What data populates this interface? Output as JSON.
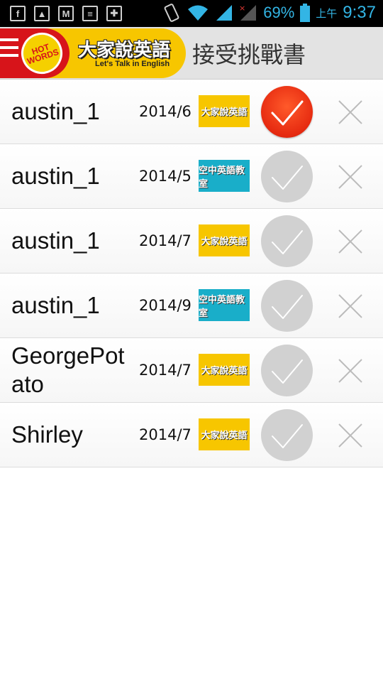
{
  "status_bar": {
    "battery": "69%",
    "time_prefix": "上午",
    "time": "9:37",
    "icons": [
      "facebook-icon",
      "gallery-icon",
      "gmail-icon",
      "bible-icon",
      "puzzle-icon",
      "vibrate-icon",
      "wifi-icon",
      "signal-icon",
      "no-signal-icon",
      "battery-icon"
    ]
  },
  "header": {
    "logo_text": "大家說英語",
    "logo_sub": "Let's Talk in English",
    "logo_badge": "HOT WORDS",
    "title": "接受挑戰書"
  },
  "challenges": [
    {
      "name": "austin_1",
      "date": "2014/6",
      "badge_text": "大家說英語",
      "accepted": true
    },
    {
      "name": "austin_1",
      "date": "2014/5",
      "badge_text": "空中英語教室",
      "accepted": false
    },
    {
      "name": "austin_1",
      "date": "2014/7",
      "badge_text": "大家說英語",
      "accepted": false
    },
    {
      "name": "austin_1",
      "date": "2014/9",
      "badge_text": "空中英語教室",
      "accepted": false
    },
    {
      "name": "GeorgePotato",
      "date": "2014/7",
      "badge_text": "大家說英語",
      "accepted": false
    },
    {
      "name": "Shirley",
      "date": "2014/7",
      "badge_text": "大家說英語",
      "accepted": false
    }
  ],
  "colors": {
    "accent_red": "#e62a10",
    "magazine_yellow": "#f7c600",
    "magazine_cyan": "#19aec9",
    "status_blue": "#33b5e5"
  }
}
